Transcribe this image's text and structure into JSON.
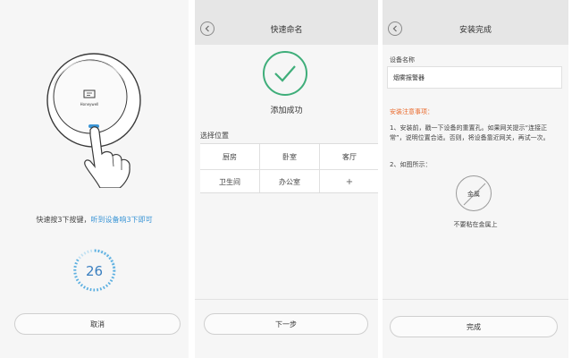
{
  "screen1": {
    "device_logo": "Honeywell",
    "instruction_main": "快速按3下按键，",
    "instruction_highlight": "听到设备响3下即可",
    "countdown_value": "26",
    "cancel_label": "取消"
  },
  "screen2": {
    "title": "快速命名",
    "success_text": "添加成功",
    "location_label": "选择位置",
    "locations": [
      "厨房",
      "卧室",
      "客厅",
      "卫生间",
      "办公室",
      "+"
    ],
    "next_label": "下一步"
  },
  "screen3": {
    "title": "安装完成",
    "device_name_label": "设备名称",
    "device_name_value": "烟雾报警器",
    "notes_title": "安装注意事项：",
    "note1": "1、安装前，戳一下设备的重置孔。如果网关提示“连接正常”，说明位置合适。否则，将设备靠近网关，再试一次。",
    "note2": "2、如图所示：",
    "metal_icon_text": "金属",
    "metal_caption": "不要粘在金属上",
    "done_label": "完成"
  },
  "colors": {
    "accent_blue": "#3a95d6",
    "success_green": "#3fae7a",
    "warning_orange": "#ea6a2c",
    "header_gray": "#e6e6e6"
  },
  "icons": {
    "back": "chevron-left-icon",
    "check": "checkmark-icon",
    "add": "plus-icon",
    "prohibited": "no-metal-icon"
  }
}
